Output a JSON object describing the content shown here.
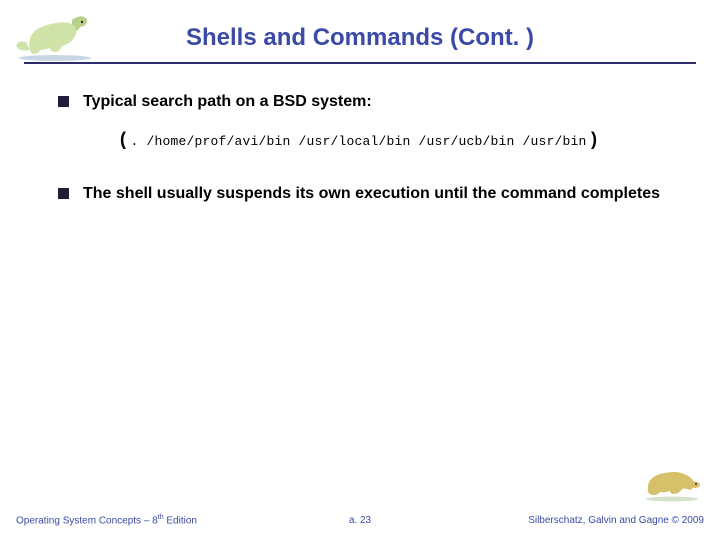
{
  "title": "Shells and Commands (Cont. )",
  "bullets": {
    "b1": "Typical search path on a BSD system:",
    "b2": "The shell usually suspends its own execution until the command completes"
  },
  "path": {
    "open": "(",
    "text": ". /home/prof/avi/bin /usr/local/bin /usr/ucb/bin /usr/bin",
    "close": ")"
  },
  "footer": {
    "left_pre": "Operating System Concepts – 8",
    "left_sup": "th",
    "left_post": " Edition",
    "center": "a. 23",
    "right": "Silberschatz, Galvin and Gagne © 2009"
  },
  "icons": {
    "dino_top": "dinosaur-icon",
    "dino_bottom": "dinosaur-icon"
  }
}
